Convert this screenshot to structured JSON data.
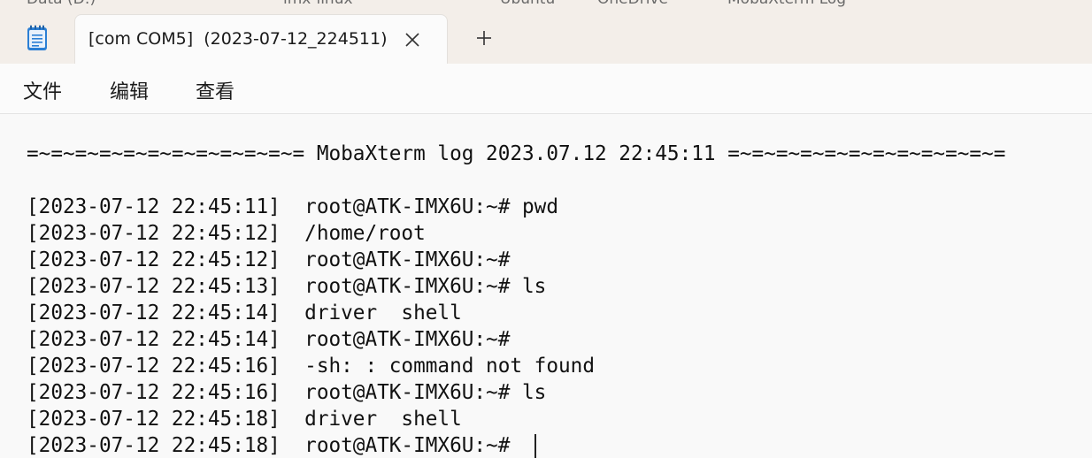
{
  "window": {
    "background_tabs": [
      "Data (D:)",
      "imx-linux",
      "Ubuntu",
      "OneDrive",
      "MobaXterm Log"
    ]
  },
  "tab": {
    "title": "[com COM5]  (2023-07-12_224511)",
    "close_glyph": "×",
    "new_tab_glyph": "+"
  },
  "menu": {
    "items": [
      "文件",
      "编辑",
      "查看"
    ]
  },
  "log": {
    "lines": [
      "=~=~=~=~=~=~=~=~=~=~=~= MobaXterm log 2023.07.12 22:45:11 =~=~=~=~=~=~=~=~=~=~=~=",
      "",
      "[2023-07-12 22:45:11]  root@ATK-IMX6U:~# pwd",
      "[2023-07-12 22:45:12]  /home/root",
      "[2023-07-12 22:45:12]  root@ATK-IMX6U:~#",
      "[2023-07-12 22:45:13]  root@ATK-IMX6U:~# ls",
      "[2023-07-12 22:45:14]  driver  shell",
      "[2023-07-12 22:45:14]  root@ATK-IMX6U:~#",
      "[2023-07-12 22:45:16]  -sh: : command not found",
      "[2023-07-12 22:45:16]  root@ATK-IMX6U:~# ls",
      "[2023-07-12 22:45:18]  driver  shell",
      "[2023-07-12 22:45:18]  root@ATK-IMX6U:~# "
    ]
  },
  "colors": {
    "tabstrip_bg": "#f3eee9",
    "content_bg": "#f9f9f9",
    "text": "#111111",
    "icon_blue": "#2b7fd4"
  },
  "icons": {
    "app": "notepad-icon",
    "close": "close-icon",
    "new_tab": "plus-icon"
  }
}
